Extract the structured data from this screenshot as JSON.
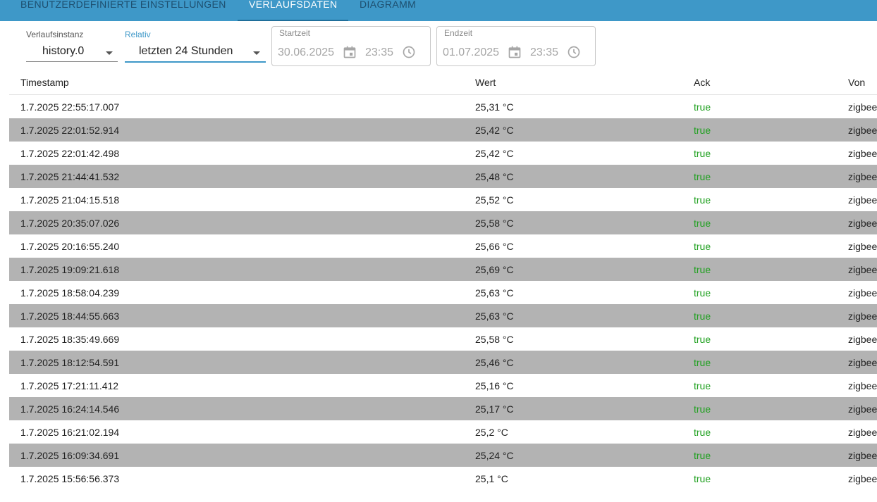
{
  "tabs": [
    {
      "label": "BENUTZERDEFINIERTE EINSTELLUNGEN",
      "active": false
    },
    {
      "label": "VERLAUFSDATEN",
      "active": true
    },
    {
      "label": "DIAGRAMM",
      "active": false
    }
  ],
  "filters": {
    "instance_label": "Verlaufsinstanz",
    "instance_value": "history.0",
    "relative_label": "Relativ",
    "relative_value": "letzten 24 Stunden",
    "start_label": "Startzeit",
    "start_date": "30.06.2025",
    "start_time": "23:35",
    "end_label": "Endzeit",
    "end_date": "01.07.2025",
    "end_time": "23:35"
  },
  "table": {
    "headers": [
      "Timestamp",
      "Wert",
      "Ack",
      "Von"
    ],
    "rows": [
      {
        "timestamp": "1.7.2025 22:55:17.007",
        "value": "25,31 °C",
        "ack": "true",
        "from": "zigbee"
      },
      {
        "timestamp": "1.7.2025 22:01:52.914",
        "value": "25,42 °C",
        "ack": "true",
        "from": "zigbee"
      },
      {
        "timestamp": "1.7.2025 22:01:42.498",
        "value": "25,42 °C",
        "ack": "true",
        "from": "zigbee"
      },
      {
        "timestamp": "1.7.2025 21:44:41.532",
        "value": "25,48 °C",
        "ack": "true",
        "from": "zigbee"
      },
      {
        "timestamp": "1.7.2025 21:04:15.518",
        "value": "25,52 °C",
        "ack": "true",
        "from": "zigbee"
      },
      {
        "timestamp": "1.7.2025 20:35:07.026",
        "value": "25,58 °C",
        "ack": "true",
        "from": "zigbee"
      },
      {
        "timestamp": "1.7.2025 20:16:55.240",
        "value": "25,66 °C",
        "ack": "true",
        "from": "zigbee"
      },
      {
        "timestamp": "1.7.2025 19:09:21.618",
        "value": "25,69 °C",
        "ack": "true",
        "from": "zigbee"
      },
      {
        "timestamp": "1.7.2025 18:58:04.239",
        "value": "25,63 °C",
        "ack": "true",
        "from": "zigbee"
      },
      {
        "timestamp": "1.7.2025 18:44:55.663",
        "value": "25,63 °C",
        "ack": "true",
        "from": "zigbee"
      },
      {
        "timestamp": "1.7.2025 18:35:49.669",
        "value": "25,58 °C",
        "ack": "true",
        "from": "zigbee"
      },
      {
        "timestamp": "1.7.2025 18:12:54.591",
        "value": "25,46 °C",
        "ack": "true",
        "from": "zigbee"
      },
      {
        "timestamp": "1.7.2025 17:21:11.412",
        "value": "25,16 °C",
        "ack": "true",
        "from": "zigbee"
      },
      {
        "timestamp": "1.7.2025 16:24:14.546",
        "value": "25,17 °C",
        "ack": "true",
        "from": "zigbee"
      },
      {
        "timestamp": "1.7.2025 16:21:02.194",
        "value": "25,2 °C",
        "ack": "true",
        "from": "zigbee"
      },
      {
        "timestamp": "1.7.2025 16:09:34.691",
        "value": "25,24 °C",
        "ack": "true",
        "from": "zigbee"
      },
      {
        "timestamp": "1.7.2025 15:56:56.373",
        "value": "25,1 °C",
        "ack": "true",
        "from": "zigbee"
      }
    ]
  },
  "icons": {
    "start_date": "calendar-icon",
    "start_time": "clock-icon",
    "end_date": "calendar-icon",
    "end_time": "clock-icon"
  },
  "colors": {
    "tabbar": "#3e98c8",
    "ack_true": "#1fa01f",
    "row_alt": "#b3b3b3"
  }
}
